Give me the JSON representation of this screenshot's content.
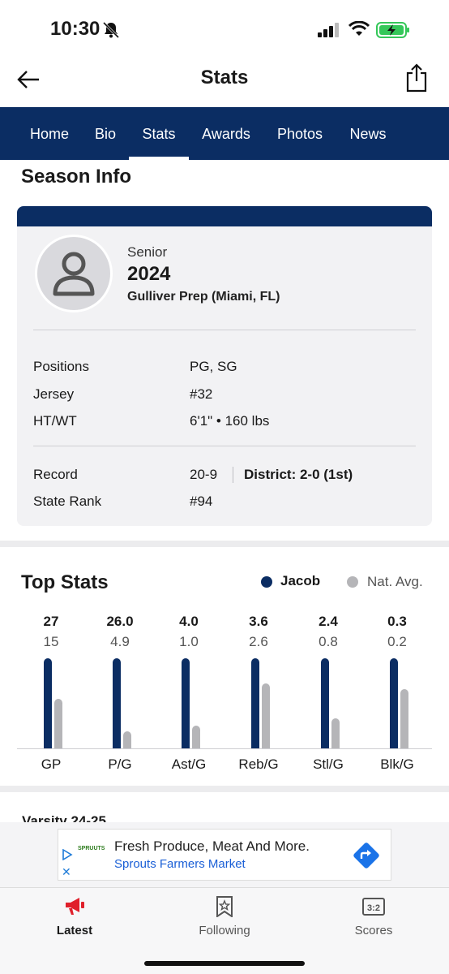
{
  "status_bar": {
    "time": "10:30"
  },
  "header": {
    "title": "Stats"
  },
  "tabs": [
    {
      "label": "Home"
    },
    {
      "label": "Bio"
    },
    {
      "label": "Stats"
    },
    {
      "label": "Awards"
    },
    {
      "label": "Photos"
    },
    {
      "label": "News"
    }
  ],
  "active_tab": "Stats",
  "season_info": {
    "title": "Season Info",
    "class_label": "Senior",
    "class_year": "2024",
    "school": "Gulliver Prep (Miami, FL)",
    "rows": [
      {
        "label": "Positions",
        "value": "PG, SG"
      },
      {
        "label": "Jersey",
        "value": "#32"
      },
      {
        "label": "HT/WT",
        "value": "6'1\" • 160 lbs"
      }
    ],
    "record_label": "Record",
    "record_value": "20-9",
    "district": "District: 2-0 (1st)",
    "state_rank_label": "State Rank",
    "state_rank_value": "#94"
  },
  "top_stats": {
    "title": "Top Stats",
    "legend_player": "Jacob",
    "legend_avg": "Nat. Avg."
  },
  "colors": {
    "primary": "#0b2d63",
    "avg": "#b5b5b8"
  },
  "chart_data": {
    "type": "bar",
    "categories": [
      "GP",
      "P/G",
      "Ast/G",
      "Reb/G",
      "Stl/G",
      "Blk/G"
    ],
    "series": [
      {
        "name": "Jacob",
        "values": [
          27,
          26.0,
          4.0,
          3.6,
          2.4,
          0.3
        ],
        "labels": [
          "27",
          "26.0",
          "4.0",
          "3.6",
          "2.4",
          "0.3"
        ]
      },
      {
        "name": "Nat. Avg.",
        "values": [
          15,
          4.9,
          1.0,
          2.6,
          0.8,
          0.2
        ],
        "labels": [
          "15",
          "4.9",
          "1.0",
          "2.6",
          "0.8",
          "0.2"
        ]
      }
    ],
    "avg_fraction_of_player": [
      0.55,
      0.19,
      0.25,
      0.72,
      0.33,
      0.66
    ]
  },
  "next_section": {
    "title": "Varsity 24-25"
  },
  "ad": {
    "title": "Fresh Produce, Meat And More.",
    "advertiser": "Sprouts Farmers Market",
    "logo_text": "SPRUUTS"
  },
  "bottom_nav": [
    {
      "label": "Latest",
      "icon": "megaphone-icon",
      "active": true
    },
    {
      "label": "Following",
      "icon": "bookmark-star-icon",
      "active": false
    },
    {
      "label": "Scores",
      "icon": "scoreboard-icon",
      "active": false
    }
  ]
}
